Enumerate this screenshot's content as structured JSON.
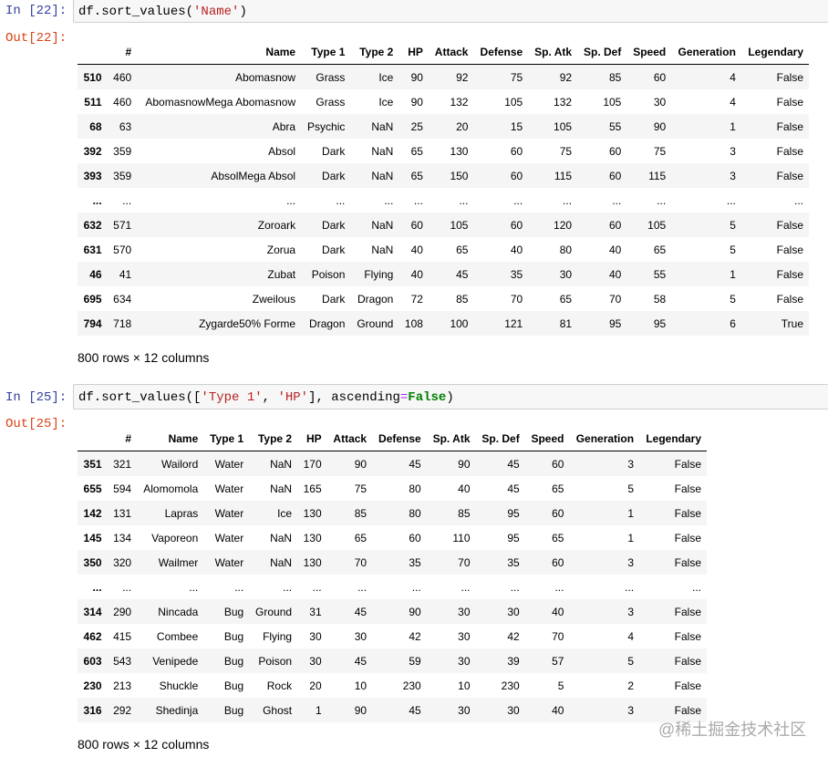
{
  "cell1": {
    "in_prompt": "In [22]:",
    "out_prompt": "Out[22]:",
    "code": {
      "fn": "df.sort_values(",
      "arg": "'Name'",
      "close": ")"
    },
    "columns": [
      "",
      "#",
      "Name",
      "Type 1",
      "Type 2",
      "HP",
      "Attack",
      "Defense",
      "Sp. Atk",
      "Sp. Def",
      "Speed",
      "Generation",
      "Legendary"
    ],
    "rows": [
      [
        "510",
        "460",
        "Abomasnow",
        "Grass",
        "Ice",
        "90",
        "92",
        "75",
        "92",
        "85",
        "60",
        "4",
        "False"
      ],
      [
        "511",
        "460",
        "AbomasnowMega Abomasnow",
        "Grass",
        "Ice",
        "90",
        "132",
        "105",
        "132",
        "105",
        "30",
        "4",
        "False"
      ],
      [
        "68",
        "63",
        "Abra",
        "Psychic",
        "NaN",
        "25",
        "20",
        "15",
        "105",
        "55",
        "90",
        "1",
        "False"
      ],
      [
        "392",
        "359",
        "Absol",
        "Dark",
        "NaN",
        "65",
        "130",
        "60",
        "75",
        "60",
        "75",
        "3",
        "False"
      ],
      [
        "393",
        "359",
        "AbsolMega Absol",
        "Dark",
        "NaN",
        "65",
        "150",
        "60",
        "115",
        "60",
        "115",
        "3",
        "False"
      ],
      [
        "...",
        "...",
        "...",
        "...",
        "...",
        "...",
        "...",
        "...",
        "...",
        "...",
        "...",
        "...",
        "..."
      ],
      [
        "632",
        "571",
        "Zoroark",
        "Dark",
        "NaN",
        "60",
        "105",
        "60",
        "120",
        "60",
        "105",
        "5",
        "False"
      ],
      [
        "631",
        "570",
        "Zorua",
        "Dark",
        "NaN",
        "40",
        "65",
        "40",
        "80",
        "40",
        "65",
        "5",
        "False"
      ],
      [
        "46",
        "41",
        "Zubat",
        "Poison",
        "Flying",
        "40",
        "45",
        "35",
        "30",
        "40",
        "55",
        "1",
        "False"
      ],
      [
        "695",
        "634",
        "Zweilous",
        "Dark",
        "Dragon",
        "72",
        "85",
        "70",
        "65",
        "70",
        "58",
        "5",
        "False"
      ],
      [
        "794",
        "718",
        "Zygarde50% Forme",
        "Dragon",
        "Ground",
        "108",
        "100",
        "121",
        "81",
        "95",
        "95",
        "6",
        "True"
      ]
    ],
    "summary": "800 rows × 12 columns"
  },
  "cell2": {
    "in_prompt": "In [25]:",
    "out_prompt": "Out[25]:",
    "code": {
      "fn": "df.sort_values([",
      "arg1": "'Type 1'",
      "sep": ", ",
      "arg2": "'HP'",
      "mid": "], ascending",
      "eq": "=",
      "kw": "False",
      "close": ")"
    },
    "columns": [
      "",
      "#",
      "Name",
      "Type 1",
      "Type 2",
      "HP",
      "Attack",
      "Defense",
      "Sp. Atk",
      "Sp. Def",
      "Speed",
      "Generation",
      "Legendary"
    ],
    "rows": [
      [
        "351",
        "321",
        "Wailord",
        "Water",
        "NaN",
        "170",
        "90",
        "45",
        "90",
        "45",
        "60",
        "3",
        "False"
      ],
      [
        "655",
        "594",
        "Alomomola",
        "Water",
        "NaN",
        "165",
        "75",
        "80",
        "40",
        "45",
        "65",
        "5",
        "False"
      ],
      [
        "142",
        "131",
        "Lapras",
        "Water",
        "Ice",
        "130",
        "85",
        "80",
        "85",
        "95",
        "60",
        "1",
        "False"
      ],
      [
        "145",
        "134",
        "Vaporeon",
        "Water",
        "NaN",
        "130",
        "65",
        "60",
        "110",
        "95",
        "65",
        "1",
        "False"
      ],
      [
        "350",
        "320",
        "Wailmer",
        "Water",
        "NaN",
        "130",
        "70",
        "35",
        "70",
        "35",
        "60",
        "3",
        "False"
      ],
      [
        "...",
        "...",
        "...",
        "...",
        "...",
        "...",
        "...",
        "...",
        "...",
        "...",
        "...",
        "...",
        "..."
      ],
      [
        "314",
        "290",
        "Nincada",
        "Bug",
        "Ground",
        "31",
        "45",
        "90",
        "30",
        "30",
        "40",
        "3",
        "False"
      ],
      [
        "462",
        "415",
        "Combee",
        "Bug",
        "Flying",
        "30",
        "30",
        "42",
        "30",
        "42",
        "70",
        "4",
        "False"
      ],
      [
        "603",
        "543",
        "Venipede",
        "Bug",
        "Poison",
        "30",
        "45",
        "59",
        "30",
        "39",
        "57",
        "5",
        "False"
      ],
      [
        "230",
        "213",
        "Shuckle",
        "Bug",
        "Rock",
        "20",
        "10",
        "230",
        "10",
        "230",
        "5",
        "2",
        "False"
      ],
      [
        "316",
        "292",
        "Shedinja",
        "Bug",
        "Ghost",
        "1",
        "90",
        "45",
        "30",
        "30",
        "40",
        "3",
        "False"
      ]
    ],
    "summary": "800 rows × 12 columns"
  },
  "watermark": "@稀土掘金技术社区"
}
